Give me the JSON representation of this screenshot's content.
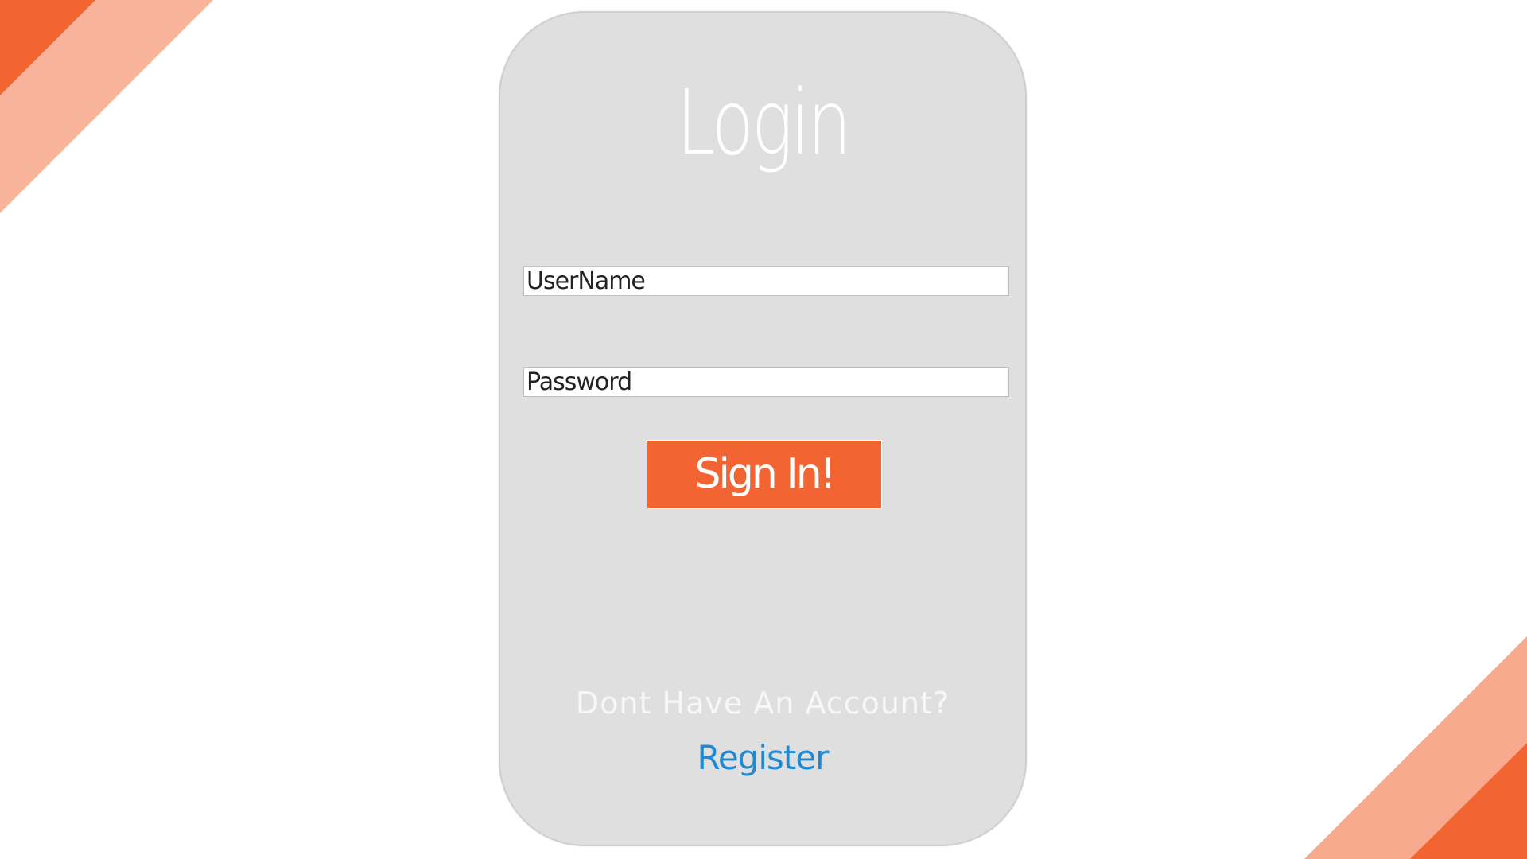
{
  "login": {
    "title": "Login",
    "username_placeholder": "UserName",
    "password_placeholder": "Password",
    "signin_label": "Sign In!",
    "no_account_text": "Dont Have An Account?",
    "register_label": "Register"
  },
  "colors": {
    "accent": "#f26532",
    "accent_light": "#f8b39a",
    "card_bg": "#dfdfdf",
    "link": "#1e8ad6"
  }
}
